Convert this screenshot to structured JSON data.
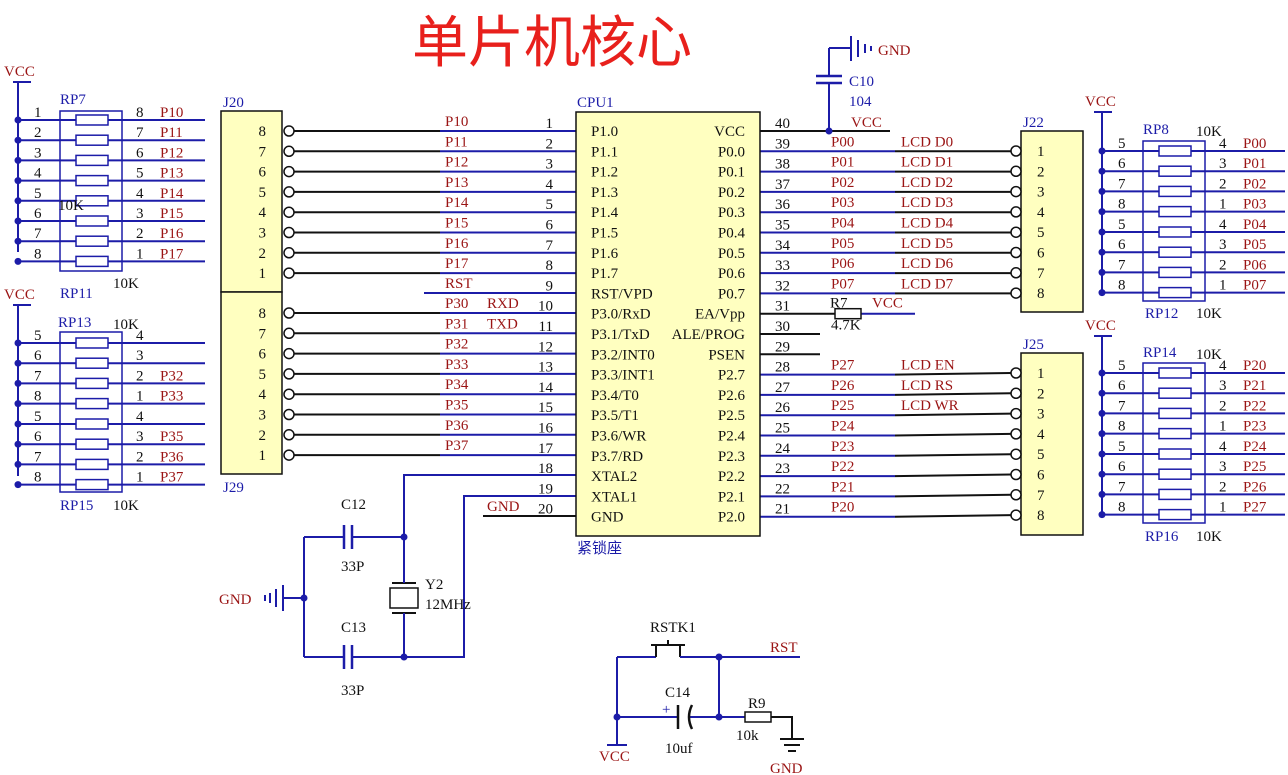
{
  "title": "单片机核心",
  "colors": {
    "title": "#e8201c",
    "wire_blue": "#1c1ca8",
    "wire_black": "#111111",
    "chip_fill": "#ffffc0",
    "label_red": "#9a1414",
    "junction": "#1c1ca8"
  },
  "cpu": {
    "ref": "CPU1",
    "socket": "紧锁座",
    "left_pins": [
      {
        "num": "1",
        "name": "P1.0",
        "net": "P10"
      },
      {
        "num": "2",
        "name": "P1.1",
        "net": "P11"
      },
      {
        "num": "3",
        "name": "P1.2",
        "net": "P12"
      },
      {
        "num": "4",
        "name": "P1.3",
        "net": "P13"
      },
      {
        "num": "5",
        "name": "P1.4",
        "net": "P14"
      },
      {
        "num": "6",
        "name": "P1.5",
        "net": "P15"
      },
      {
        "num": "7",
        "name": "P1.6",
        "net": "P16"
      },
      {
        "num": "8",
        "name": "P1.7",
        "net": "P17"
      },
      {
        "num": "9",
        "name": "RST/VPD",
        "net": "RST"
      },
      {
        "num": "10",
        "name": "P3.0/RxD",
        "net": "P30 RXD"
      },
      {
        "num": "11",
        "name": "P3.1/TxD",
        "net": "P31 TXD"
      },
      {
        "num": "12",
        "name": "P3.2/INT0",
        "net": "P32"
      },
      {
        "num": "13",
        "name": "P3.3/INT1",
        "net": "P33"
      },
      {
        "num": "14",
        "name": "P3.4/T0",
        "net": "P34"
      },
      {
        "num": "15",
        "name": "P3.5/T1",
        "net": "P35"
      },
      {
        "num": "16",
        "name": "P3.6/WR",
        "net": "P36"
      },
      {
        "num": "17",
        "name": "P3.7/RD",
        "net": "P37"
      },
      {
        "num": "18",
        "name": "XTAL2",
        "net": ""
      },
      {
        "num": "19",
        "name": "XTAL1",
        "net": ""
      },
      {
        "num": "20",
        "name": "GND",
        "net": "GND"
      }
    ],
    "right_pins": [
      {
        "num": "40",
        "name": "VCC",
        "net": "VCC",
        "lcd": ""
      },
      {
        "num": "39",
        "name": "P0.0",
        "net": "P00",
        "lcd": "LCD  D0"
      },
      {
        "num": "38",
        "name": "P0.1",
        "net": "P01",
        "lcd": "LCD  D1"
      },
      {
        "num": "37",
        "name": "P0.2",
        "net": "P02",
        "lcd": "LCD  D2"
      },
      {
        "num": "36",
        "name": "P0.3",
        "net": "P03",
        "lcd": "LCD  D3"
      },
      {
        "num": "35",
        "name": "P0.4",
        "net": "P04",
        "lcd": "LCD  D4"
      },
      {
        "num": "34",
        "name": "P0.5",
        "net": "P05",
        "lcd": "LCD  D5"
      },
      {
        "num": "33",
        "name": "P0.6",
        "net": "P06",
        "lcd": "LCD  D6"
      },
      {
        "num": "32",
        "name": "P0.7",
        "net": "P07",
        "lcd": "LCD  D7"
      },
      {
        "num": "31",
        "name": "EA/Vpp",
        "net": "",
        "lcd": ""
      },
      {
        "num": "30",
        "name": "ALE/PROG",
        "net": "",
        "lcd": ""
      },
      {
        "num": "29",
        "name": "PSEN",
        "net": "",
        "lcd": ""
      },
      {
        "num": "28",
        "name": "P2.7",
        "net": "P27",
        "lcd": "LCD  EN"
      },
      {
        "num": "27",
        "name": "P2.6",
        "net": "P26",
        "lcd": "LCD  RS"
      },
      {
        "num": "26",
        "name": "P2.5",
        "net": "P25",
        "lcd": "LCD  WR"
      },
      {
        "num": "25",
        "name": "P2.4",
        "net": "P24",
        "lcd": ""
      },
      {
        "num": "24",
        "name": "P2.3",
        "net": "P23",
        "lcd": ""
      },
      {
        "num": "23",
        "name": "P2.2",
        "net": "P22",
        "lcd": ""
      },
      {
        "num": "22",
        "name": "P2.1",
        "net": "P21",
        "lcd": ""
      },
      {
        "num": "21",
        "name": "P2.0",
        "net": "P20",
        "lcd": ""
      }
    ]
  },
  "r7": {
    "ref": "R7",
    "value": "4.7K",
    "vcc": "VCC"
  },
  "c10": {
    "ref": "C10",
    "value": "104",
    "gnd": "GND",
    "vcc": "VCC"
  },
  "j20": {
    "ref": "J20",
    "pins": [
      "8",
      "7",
      "6",
      "5",
      "4",
      "3",
      "2",
      "1"
    ]
  },
  "j29": {
    "ref": "J29",
    "pins": [
      "8",
      "7",
      "6",
      "5",
      "4",
      "3",
      "2",
      "1"
    ]
  },
  "j22": {
    "ref": "J22",
    "pins": [
      "1",
      "2",
      "3",
      "4",
      "5",
      "6",
      "7",
      "8"
    ]
  },
  "j25": {
    "ref": "J25",
    "pins": [
      "1",
      "2",
      "3",
      "4",
      "5",
      "6",
      "7",
      "8"
    ]
  },
  "rp_left_top": {
    "vcc": "VCC",
    "rp7": {
      "ref": "RP7",
      "value": "10K",
      "left": [
        "1",
        "2",
        "3",
        "4",
        "5"
      ],
      "right": [
        "8",
        "7",
        "6",
        "5",
        "4"
      ],
      "nets": [
        "P10",
        "P11",
        "P12",
        "P13",
        "P14"
      ]
    },
    "rp11": {
      "ref": "RP11",
      "value": "10K",
      "left": [
        "6",
        "7",
        "8"
      ],
      "right": [
        "3",
        "2",
        "1"
      ],
      "nets": [
        "P15",
        "P16",
        "P17"
      ]
    }
  },
  "rp_left_bot": {
    "vcc": "VCC",
    "rp13": {
      "ref": "RP13",
      "value": "10K",
      "left": [
        "5",
        "6",
        "7",
        "8"
      ],
      "right": [
        "4",
        "3",
        "2",
        "1"
      ],
      "nets": [
        "",
        "",
        "P32",
        "P33"
      ]
    },
    "rp15": {
      "ref": "RP15",
      "value": "10K",
      "left": [
        "5",
        "6",
        "7",
        "8"
      ],
      "right": [
        "4",
        "3",
        "2",
        "1"
      ],
      "nets": [
        "",
        "P35",
        "P36",
        "P37"
      ]
    }
  },
  "rp_right_top": {
    "vcc": "VCC",
    "rp8": {
      "ref": "RP8",
      "value": "10K",
      "left": [
        "5",
        "6",
        "7",
        "8"
      ],
      "right": [
        "4",
        "3",
        "2",
        "1"
      ],
      "nets": [
        "P00",
        "P01",
        "P02",
        "P03"
      ]
    },
    "rp12": {
      "ref": "RP12",
      "value": "10K",
      "left": [
        "5",
        "6",
        "7",
        "8"
      ],
      "right": [
        "4",
        "3",
        "2",
        "1"
      ],
      "nets": [
        "P04",
        "P05",
        "P06",
        "P07"
      ]
    }
  },
  "rp_right_bot": {
    "vcc": "VCC",
    "rp14": {
      "ref": "RP14",
      "value": "10K",
      "left": [
        "5",
        "6",
        "7",
        "8"
      ],
      "right": [
        "4",
        "3",
        "2",
        "1"
      ],
      "nets": [
        "P20",
        "P21",
        "P22",
        "P23"
      ]
    },
    "rp16": {
      "ref": "RP16",
      "value": "10K",
      "left": [
        "5",
        "6",
        "7",
        "8"
      ],
      "right": [
        "4",
        "3",
        "2",
        "1"
      ],
      "nets": [
        "P24",
        "P25",
        "P26",
        "P27"
      ]
    }
  },
  "crystal": {
    "c12": "C12",
    "c12v": "33P",
    "c13": "C13",
    "c13v": "33P",
    "y2": "Y2",
    "y2v": "12MHz",
    "gnd": "GND"
  },
  "reset": {
    "sw": "RSTK1",
    "rst": "RST",
    "c14": "C14",
    "c14v": "10uf",
    "r9": "R9",
    "r9v": "10k",
    "vcc": "VCC",
    "gnd": "GND",
    "plus": "+"
  }
}
